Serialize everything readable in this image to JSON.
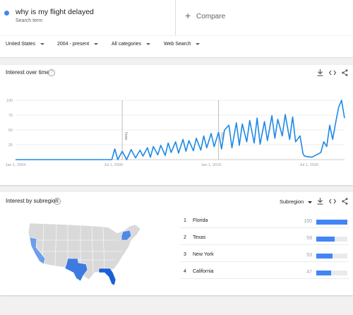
{
  "search": {
    "term": "why is my flight delayed",
    "term_sub": "Search term",
    "compare_label": "Compare",
    "term_color": "#4285f4"
  },
  "filters": {
    "location": "United States",
    "time": "2004 - present",
    "category": "All categories",
    "type": "Web Search"
  },
  "interest_over_time": {
    "title": "Interest over time",
    "help_icon": "help-circle-icon",
    "tools": [
      "download-icon",
      "embed-code-icon",
      "share-icon"
    ],
    "notes": [
      "Note",
      "Note"
    ]
  },
  "chart_data": {
    "type": "line",
    "title": "Interest over time",
    "ylim": [
      0,
      100
    ],
    "yticks": [
      100,
      75,
      50,
      25
    ],
    "xticks": [
      "Jan 1, 2004",
      "Jul 1, 2009",
      "Jan 1, 2015",
      "Jul 1, 2020"
    ],
    "x_range": [
      "2004-01",
      "2022-07"
    ],
    "grid": true,
    "series": [
      {
        "color": "#1e88e5",
        "x": [
          "2004-01",
          "2009-06",
          "2009-08",
          "2009-10",
          "2010-01",
          "2010-04",
          "2010-07",
          "2010-10",
          "2011-01",
          "2011-03",
          "2011-06",
          "2011-08",
          "2011-10",
          "2012-01",
          "2012-03",
          "2012-06",
          "2012-08",
          "2012-10",
          "2013-01",
          "2013-03",
          "2013-06",
          "2013-08",
          "2013-10",
          "2014-01",
          "2014-03",
          "2014-06",
          "2014-08",
          "2014-10",
          "2015-01",
          "2015-03",
          "2015-06",
          "2015-08",
          "2015-10",
          "2016-01",
          "2016-03",
          "2016-06",
          "2016-08",
          "2016-10",
          "2017-01",
          "2017-03",
          "2017-06",
          "2017-08",
          "2017-10",
          "2018-01",
          "2018-03",
          "2018-06",
          "2018-08",
          "2018-10",
          "2019-01",
          "2019-03",
          "2019-06",
          "2019-08",
          "2019-10",
          "2020-01",
          "2020-03",
          "2020-04",
          "2020-06",
          "2020-09",
          "2020-12",
          "2021-03",
          "2021-05",
          "2021-07",
          "2021-09",
          "2021-11",
          "2022-01",
          "2022-03",
          "2022-05",
          "2022-07"
        ],
        "values": [
          0,
          0,
          18,
          0,
          14,
          0,
          17,
          3,
          16,
          6,
          20,
          4,
          22,
          8,
          24,
          7,
          28,
          12,
          30,
          11,
          34,
          14,
          32,
          15,
          36,
          16,
          40,
          20,
          44,
          22,
          46,
          18,
          50,
          58,
          20,
          62,
          24,
          60,
          30,
          66,
          28,
          70,
          26,
          64,
          32,
          74,
          36,
          68,
          40,
          76,
          34,
          72,
          30,
          40,
          10,
          6,
          5,
          4,
          8,
          12,
          30,
          22,
          58,
          34,
          62,
          88,
          100,
          70
        ]
      }
    ]
  },
  "interest_by_subregion": {
    "title": "Interest by subregion",
    "help_icon": "help-circle-icon",
    "dropdown": "Subregion",
    "tools": [
      "download-icon",
      "embed-code-icon",
      "share-icon"
    ],
    "map_highlight_color": "#4285f4",
    "map_base_color": "#d9d9d9",
    "rows": [
      {
        "rank": "1",
        "name": "Florida",
        "score": "100",
        "value": 100
      },
      {
        "rank": "2",
        "name": "Texas",
        "score": "59",
        "value": 59
      },
      {
        "rank": "3",
        "name": "New York",
        "score": "53",
        "value": 53
      },
      {
        "rank": "4",
        "name": "California",
        "score": "47",
        "value": 47
      }
    ]
  }
}
